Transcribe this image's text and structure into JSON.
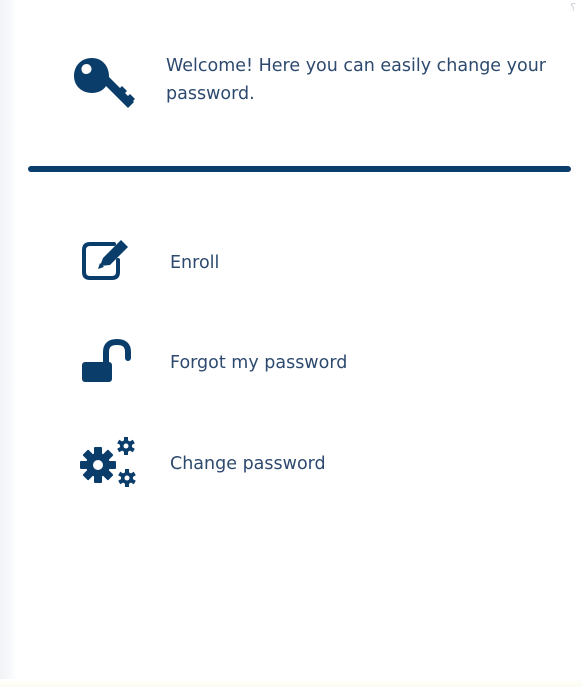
{
  "header": {
    "welcome_text": "Welcome! Here you can easily change your password.",
    "icon": "key-icon"
  },
  "menu": {
    "items": [
      {
        "id": "enroll",
        "label": "Enroll",
        "icon": "edit-square-icon"
      },
      {
        "id": "forgot",
        "label": "Forgot my password",
        "icon": "unlocked-padlock-icon"
      },
      {
        "id": "change",
        "label": "Change password",
        "icon": "gears-icon"
      }
    ]
  },
  "colors": {
    "primary": "#0b3d6b",
    "text": "#2d4a6e",
    "background": "#ffffff"
  }
}
